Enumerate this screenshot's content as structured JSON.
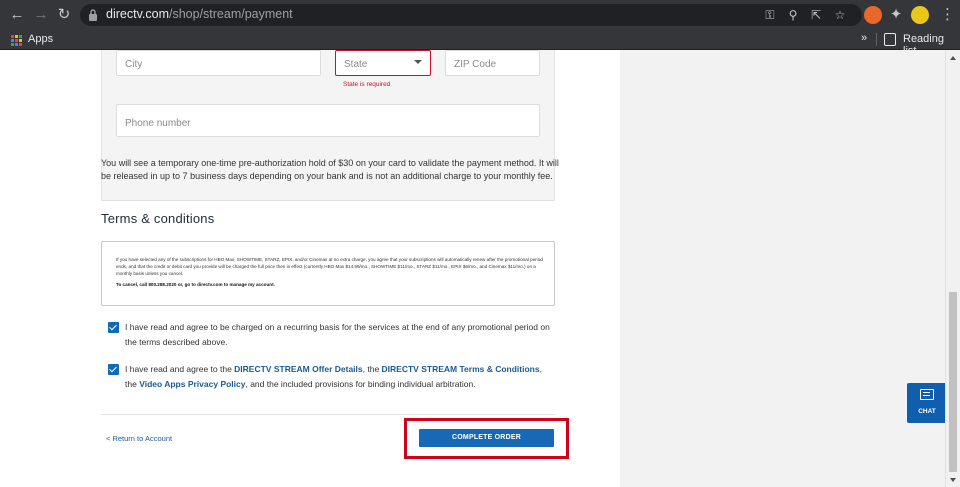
{
  "browser": {
    "url_host": "directv.com",
    "url_path": "/shop/stream/payment",
    "bookmarks": {
      "apps_label": "Apps",
      "reading_list_label": "Reading list"
    }
  },
  "form": {
    "city_placeholder": "City",
    "state_placeholder": "State",
    "state_error": "State is required",
    "zip_placeholder": "ZIP Code",
    "phone_placeholder": "Phone number",
    "preauth_note": "You will see a temporary one-time pre-authorization hold of $30 on your card to validate the payment method. It will be released in up to 7 business days depending on your bank and is not an additional charge to your monthly fee."
  },
  "terms": {
    "title": "Terms & conditions",
    "body": "If you have selected any of the subscriptions for HBO Max, SHOWTIME, STARZ, EPIX, and/or Cinemax at no extra charge, you agree that your subscriptions will automatically renew after the promotional period ends, and that the credit or debit card you provide will be charged the full price then in effect (currently HBO Max $14.99/mo., SHOWTIME $11/mo., STARZ $11/mo., EPIX $6/mo., and Cinemax $11/mo.) on a monthly basis unless you cancel.",
    "cancel_line": "To cancel, call 800.288.2020 or, go to directv.com to manage my account."
  },
  "agreements": {
    "recurring": "I have read and agree to be charged on a recurring basis for the services at the end of any promotional period on the terms described above.",
    "offer_prefix": "I have read and agree to the ",
    "offer_link": "DIRECTV STREAM Offer Details",
    "offer_mid": ",  the ",
    "terms_link": "DIRECTV STREAM Terms & Conditions",
    "offer_mid2": ", the ",
    "privacy_link": "Video Apps Privacy Policy",
    "offer_suffix": ", and the included provisions for binding individual arbitration.",
    "recurring_checked": true,
    "offer_checked": true
  },
  "actions": {
    "return_label": "< Return to Account",
    "complete_label": "COMPLETE ORDER"
  },
  "chat": {
    "label": "CHAT"
  },
  "colors": {
    "accent": "#1769b8",
    "error": "#c8102e",
    "highlight": "#d0021b",
    "chat": "#0f5fae"
  }
}
